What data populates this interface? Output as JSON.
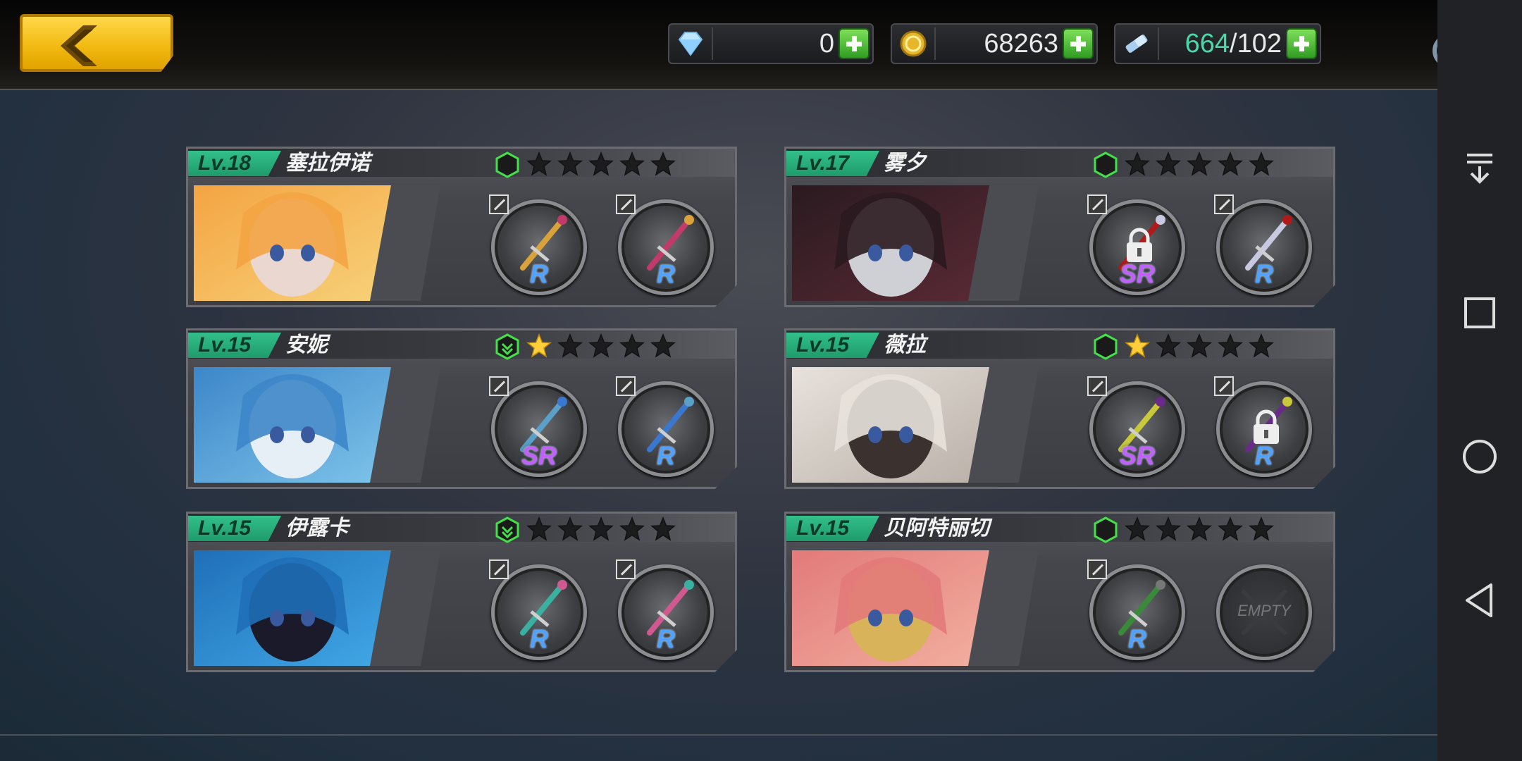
{
  "currency": {
    "diamonds": "0",
    "gold": "68263",
    "tickets_current": "664",
    "tickets_max": "/102"
  },
  "colors": {
    "level_badge": "#2fbf89",
    "rank_hex": "#44e04a",
    "star_gold": "#ffce3a",
    "rarity_r": "#4fa3ff",
    "rarity_sr": "#c060ff",
    "back_button": "#f3bc12"
  },
  "characters": [
    {
      "level": "Lv.18",
      "name": "塞拉伊诺",
      "stars": 0,
      "rank_arrow": false,
      "slot1": {
        "rarity": "R",
        "state": "equipped"
      },
      "slot2": {
        "rarity": "R",
        "state": "equipped"
      }
    },
    {
      "level": "Lv.17",
      "name": "雾夕",
      "stars": 0,
      "rank_arrow": false,
      "slot1": {
        "rarity": "SR",
        "state": "locked"
      },
      "slot2": {
        "rarity": "R",
        "state": "equipped"
      }
    },
    {
      "level": "Lv.15",
      "name": "安妮",
      "stars": 1,
      "rank_arrow": true,
      "slot1": {
        "rarity": "SR",
        "state": "equipped"
      },
      "slot2": {
        "rarity": "R",
        "state": "equipped"
      }
    },
    {
      "level": "Lv.15",
      "name": "薇拉",
      "stars": 1,
      "rank_arrow": false,
      "slot1": {
        "rarity": "SR",
        "state": "equipped"
      },
      "slot2": {
        "rarity": "R",
        "state": "locked"
      }
    },
    {
      "level": "Lv.15",
      "name": "伊露卡",
      "stars": 0,
      "rank_arrow": true,
      "slot1": {
        "rarity": "R",
        "state": "equipped"
      },
      "slot2": {
        "rarity": "R",
        "state": "equipped"
      }
    },
    {
      "level": "Lv.15",
      "name": "贝阿特丽切",
      "stars": 0,
      "rank_arrow": false,
      "slot1": {
        "rarity": "R",
        "state": "equipped"
      },
      "slot2": {
        "rarity": "",
        "state": "empty",
        "label": "EMPTY"
      }
    }
  ],
  "icons": {
    "back": "chevron-left-icon",
    "diamond": "diamond-icon",
    "gold": "gold-coin-icon",
    "ticket": "ticket-icon",
    "settings": "ring-settings-icon",
    "nav_dropdown": "pull-down-icon",
    "nav_recent": "square-icon",
    "nav_home": "circle-icon",
    "nav_back": "triangle-back-icon"
  }
}
